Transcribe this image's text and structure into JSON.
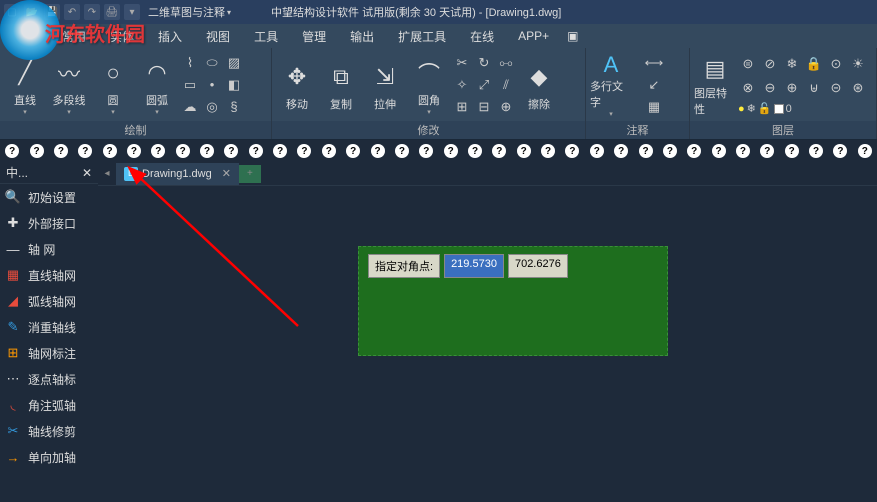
{
  "title_bar": {
    "workspace": "二维草图与注释",
    "app_title": "中望结构设计软件 试用版(剩余 30 天试用) - [Drawing1.dwg]"
  },
  "menu": [
    "常用",
    "实体",
    "插入",
    "视图",
    "工具",
    "管理",
    "输出",
    "扩展工具",
    "在线",
    "APP+"
  ],
  "ribbon": {
    "draw": {
      "title": "绘制",
      "line": "直线",
      "polyline": "多段线",
      "circle": "圆",
      "arc": "圆弧"
    },
    "modify": {
      "title": "修改",
      "move": "移动",
      "copy": "复制",
      "stretch": "拉伸",
      "fillet": "圆角",
      "erase": "擦除"
    },
    "annotate": {
      "title": "注释",
      "mtext": "多行文字"
    },
    "layer": {
      "title": "图层",
      "props": "图层特性",
      "current": "0"
    }
  },
  "sidebar": {
    "title": "中...",
    "items": [
      {
        "icon": "🔍",
        "label": "初始设置",
        "color": "#ff9800"
      },
      {
        "icon": "✚",
        "label": "外部接口",
        "color": "#ddd"
      },
      {
        "icon": "—",
        "label": "轴    网",
        "color": "#ddd"
      },
      {
        "icon": "▦",
        "label": "直线轴网",
        "color": "#e74c3c"
      },
      {
        "icon": "◢",
        "label": "弧线轴网",
        "color": "#e74c3c"
      },
      {
        "icon": "✎",
        "label": "消重轴线",
        "color": "#3498db"
      },
      {
        "icon": "⊞",
        "label": "轴网标注",
        "color": "#ff9800"
      },
      {
        "icon": "⋯",
        "label": "逐点轴标",
        "color": "#ddd"
      },
      {
        "icon": "◟",
        "label": "角注弧轴",
        "color": "#e74c3c"
      },
      {
        "icon": "✂",
        "label": "轴线修剪",
        "color": "#3498db"
      },
      {
        "icon": "→",
        "label": "单向加轴",
        "color": "#ff9800"
      }
    ]
  },
  "doc": {
    "tab_name": "Drawing1.dwg"
  },
  "prompt": {
    "label": "指定对角点:",
    "val1": "219.5730",
    "val2": "702.6276"
  }
}
